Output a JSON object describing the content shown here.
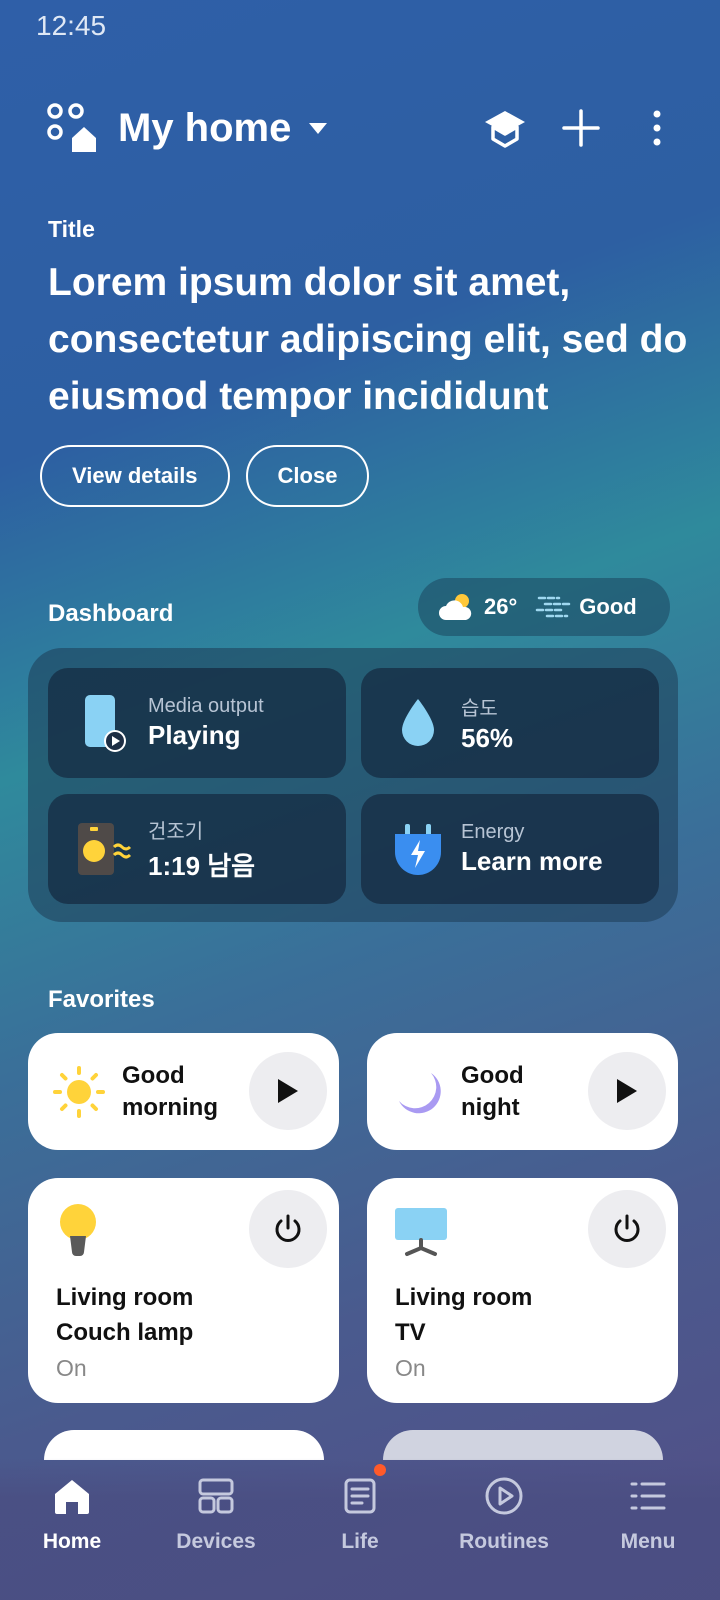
{
  "status_bar": {
    "time": "12:45"
  },
  "header": {
    "home_name": "My home",
    "home_icon": "smart-home-icon",
    "actions": [
      "learning-hat-icon",
      "plus-icon",
      "more-vertical-icon"
    ]
  },
  "notice": {
    "label": "Title",
    "text": "Lorem ipsum dolor sit amet, consectetur adipiscing elit, sed do eiusmod tempor incididunt",
    "view_details": "View details",
    "close": "Close"
  },
  "dashboard": {
    "label": "Dashboard",
    "weather": {
      "temperature": "26°",
      "air_quality": "Good"
    },
    "tiles": [
      {
        "sub": "Media output",
        "main": "Playing",
        "icon": "phone-media-icon"
      },
      {
        "sub": "습도",
        "main": "56%",
        "icon": "water-drop-icon"
      },
      {
        "sub": "건조기",
        "main": "1:19 남음",
        "icon": "dryer-icon"
      },
      {
        "sub": "Energy",
        "main": "Learn more",
        "icon": "energy-plug-icon"
      }
    ]
  },
  "favorites": {
    "label": "Favorites",
    "scenes": [
      {
        "name": "Good morning",
        "icon": "sun-icon"
      },
      {
        "name": "Good night",
        "icon": "moon-icon"
      }
    ],
    "devices": [
      {
        "room": "Living room",
        "name": "Couch lamp",
        "status": "On",
        "icon": "lamp-icon"
      },
      {
        "room": "Living room",
        "name": "TV",
        "status": "On",
        "icon": "tv-icon"
      }
    ]
  },
  "nav": {
    "items": [
      {
        "label": "Home",
        "icon": "home-icon",
        "active": true
      },
      {
        "label": "Devices",
        "icon": "devices-grid-icon",
        "active": false
      },
      {
        "label": "Life",
        "icon": "life-document-icon",
        "active": false,
        "badge": true
      },
      {
        "label": "Routines",
        "icon": "routines-play-icon",
        "active": false
      },
      {
        "label": "Menu",
        "icon": "menu-list-icon",
        "active": false
      }
    ]
  },
  "colors": {
    "accent_yellow": "#ffd33a",
    "moon_purple": "#a99af2",
    "badge": "#ff5a2a",
    "card_bg": "#ffffff"
  }
}
